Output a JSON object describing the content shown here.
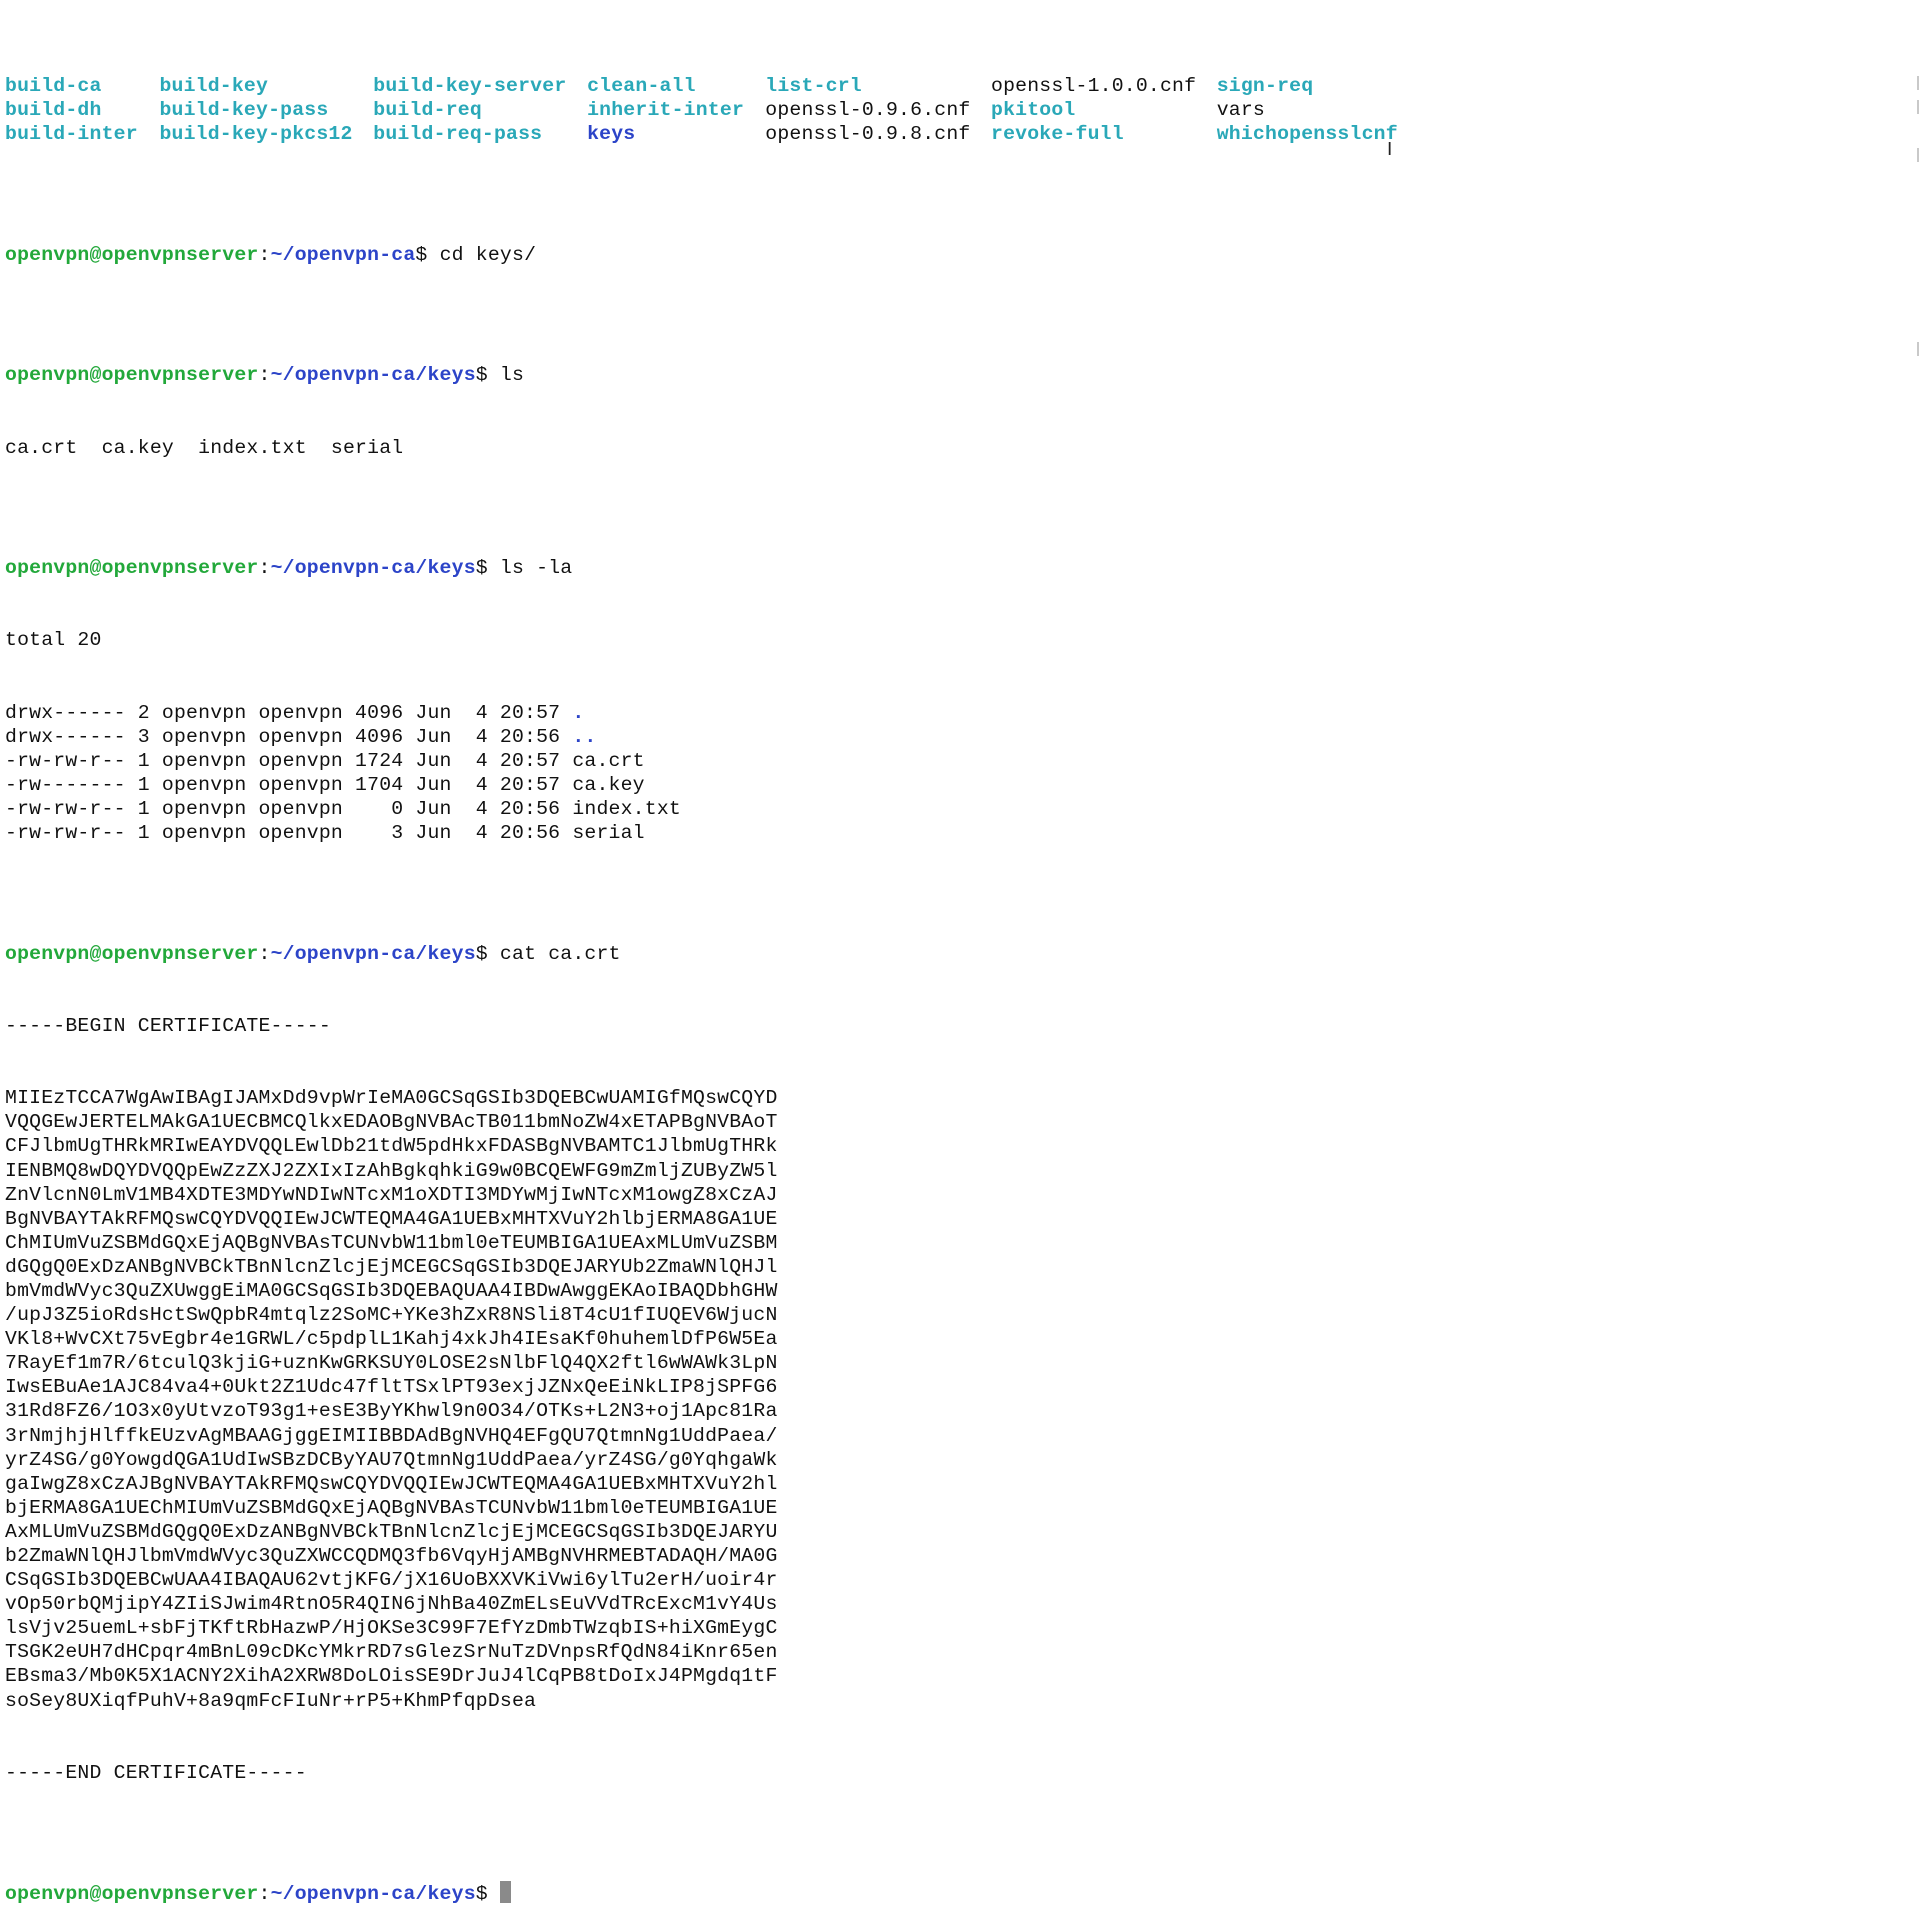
{
  "listing_rows": [
    [
      {
        "text": "build-ca",
        "type": "exec"
      },
      {
        "text": "build-key",
        "type": "exec"
      },
      {
        "text": "build-key-server",
        "type": "exec"
      },
      {
        "text": "clean-all",
        "type": "exec"
      },
      {
        "text": "list-crl",
        "type": "exec"
      },
      {
        "text": "openssl-1.0.0.cnf",
        "type": "file"
      },
      {
        "text": "sign-req",
        "type": "exec"
      }
    ],
    [
      {
        "text": "build-dh",
        "type": "exec"
      },
      {
        "text": "build-key-pass",
        "type": "exec"
      },
      {
        "text": "build-req",
        "type": "exec"
      },
      {
        "text": "inherit-inter",
        "type": "exec"
      },
      {
        "text": "openssl-0.9.6.cnf",
        "type": "file"
      },
      {
        "text": "pkitool",
        "type": "exec"
      },
      {
        "text": "vars",
        "type": "file"
      }
    ],
    [
      {
        "text": "build-inter",
        "type": "exec"
      },
      {
        "text": "build-key-pkcs12",
        "type": "exec"
      },
      {
        "text": "build-req-pass",
        "type": "exec"
      },
      {
        "text": "keys",
        "type": "dir"
      },
      {
        "text": "openssl-0.9.8.cnf",
        "type": "file"
      },
      {
        "text": "revoke-full",
        "type": "exec"
      },
      {
        "text": "whichopensslcnf",
        "type": "exec"
      }
    ]
  ],
  "prompt": {
    "user_host": "openvpn@openvpnserver",
    "path_ca": "~/openvpn-ca",
    "path_keys": "~/openvpn-ca/keys",
    "separator": ":",
    "symbol": "$"
  },
  "commands": {
    "cd": "cd keys/",
    "ls": "ls",
    "ls_la": "ls -la",
    "cat": "cat ca.crt"
  },
  "ls_output": "ca.crt  ca.key  index.txt  serial",
  "ls_la": {
    "total": "total 20",
    "entries": [
      {
        "meta": "drwx------ 2 openvpn openvpn 4096 Jun  4 20:57 ",
        "name": ".",
        "is_dir": true
      },
      {
        "meta": "drwx------ 3 openvpn openvpn 4096 Jun  4 20:56 ",
        "name": "..",
        "is_dir": true
      },
      {
        "meta": "-rw-rw-r-- 1 openvpn openvpn 1724 Jun  4 20:57 ",
        "name": "ca.crt",
        "is_dir": false
      },
      {
        "meta": "-rw------- 1 openvpn openvpn 1704 Jun  4 20:57 ",
        "name": "ca.key",
        "is_dir": false
      },
      {
        "meta": "-rw-rw-r-- 1 openvpn openvpn    0 Jun  4 20:56 ",
        "name": "index.txt",
        "is_dir": false
      },
      {
        "meta": "-rw-rw-r-- 1 openvpn openvpn    3 Jun  4 20:56 ",
        "name": "serial",
        "is_dir": false
      }
    ]
  },
  "certificate": {
    "begin": "-----BEGIN CERTIFICATE-----",
    "lines": [
      "MIIEzTCCA7WgAwIBAgIJAMxDd9vpWrIeMA0GCSqGSIb3DQEBCwUAMIGfMQswCQYD",
      "VQQGEwJERTELMAkGA1UECBMCQlkxEDAOBgNVBAcTB011bmNoZW4xETAPBgNVBAoT",
      "CFJlbmUgTHRkMRIwEAYDVQQLEwlDb21tdW5pdHkxFDASBgNVBAMTC1JlbmUgTHRk",
      "IENBMQ8wDQYDVQQpEwZzZXJ2ZXIxIzAhBgkqhkiG9w0BCQEWFG9mZmljZUByZW5l",
      "ZnVlcnN0LmV1MB4XDTE3MDYwNDIwNTcxM1oXDTI3MDYwMjIwNTcxM1owgZ8xCzAJ",
      "BgNVBAYTAkRFMQswCQYDVQQIEwJCWTEQMA4GA1UEBxMHTXVuY2hlbjERMA8GA1UE",
      "ChMIUmVuZSBMdGQxEjAQBgNVBAsTCUNvbW11bml0eTEUMBIGA1UEAxMLUmVuZSBM",
      "dGQgQ0ExDzANBgNVBCkTBnNlcnZlcjEjMCEGCSqGSIb3DQEJARYUb2ZmaWNlQHJl",
      "bmVmdWVyc3QuZXUwggEiMA0GCSqGSIb3DQEBAQUAA4IBDwAwggEKAoIBAQDbhGHW",
      "/upJ3Z5ioRdsHctSwQpbR4mtqlz2SoMC+YKe3hZxR8NSli8T4cU1fIUQEV6WjucN",
      "VKl8+WvCXt75vEgbr4e1GRWL/c5pdplL1Kahj4xkJh4IEsaKf0huhemlDfP6W5Ea",
      "7RayEf1m7R/6tculQ3kjiG+uznKwGRKSUY0LOSE2sNlbFlQ4QX2ftl6wWAWk3LpN",
      "IwsEBuAe1AJC84va4+0Ukt2Z1Udc47fltTSxlPT93exjJZNxQeEiNkLIP8jSPFG6",
      "31Rd8FZ6/1O3x0yUtvzoT93g1+esE3ByYKhwl9n0O34/OTKs+L2N3+oj1Apc81Ra",
      "3rNmjhjHlffkEUzvAgMBAAGjggEIMIIBBDAdBgNVHQ4EFgQU7QtmnNg1UddPaea/",
      "yrZ4SG/g0YowgdQGA1UdIwSBzDCByYAU7QtmnNg1UddPaea/yrZ4SG/g0YqhgaWk",
      "gaIwgZ8xCzAJBgNVBAYTAkRFMQswCQYDVQQIEwJCWTEQMA4GA1UEBxMHTXVuY2hl",
      "bjERMA8GA1UEChMIUmVuZSBMdGQxEjAQBgNVBAsTCUNvbW11bml0eTEUMBIGA1UE",
      "AxMLUmVuZSBMdGQgQ0ExDzANBgNVBCkTBnNlcnZlcjEjMCEGCSqGSIb3DQEJARYU",
      "b2ZmaWNlQHJlbmVmdWVyc3QuZXWCCQDMQ3fb6VqyHjAMBgNVHRMEBTADAQH/MA0G",
      "CSqGSIb3DQEBCwUAA4IBAQAU62vtjKFG/jX16UoBXXVKiVwi6ylTu2erH/uoir4r",
      "vOp50rbQMjipY4ZIiSJwim4RtnO5R4QIN6jNhBa40ZmELsEuVVdTRcExcM1vY4Us",
      "lsVjv25uemL+sbFjTKftRbHazwP/HjOKSe3C99F7EfYzDmbTWzqbIS+hiXGmEygC",
      "TSGK2eUH7dHCpqr4mBnL09cDKcYMkrRD7sGlezSrNuTzDVnpsRfQdN84iKnr65en",
      "EBsma3/Mb0K5X1ACNY2XihA2XRW8DoLOisSE9DrJuJ4lCqPB8tDoIxJ4PMgdq1tF",
      "soSey8UXiqfPuhV+8a9qmFcFIuNr+rP5+KhmPfqpDsea"
    ],
    "end": "-----END CERTIFICATE-----"
  },
  "colors": {
    "exec_cyan": "#2aa8b8",
    "prompt_green": "#22a83a",
    "path_blue": "#2c44c8",
    "text": "#111111",
    "background": "#ffffff",
    "cursor": "#8a8a8a"
  },
  "icons": {
    "text_cursor": "i-beam-icon",
    "block_cursor": "block-cursor"
  }
}
